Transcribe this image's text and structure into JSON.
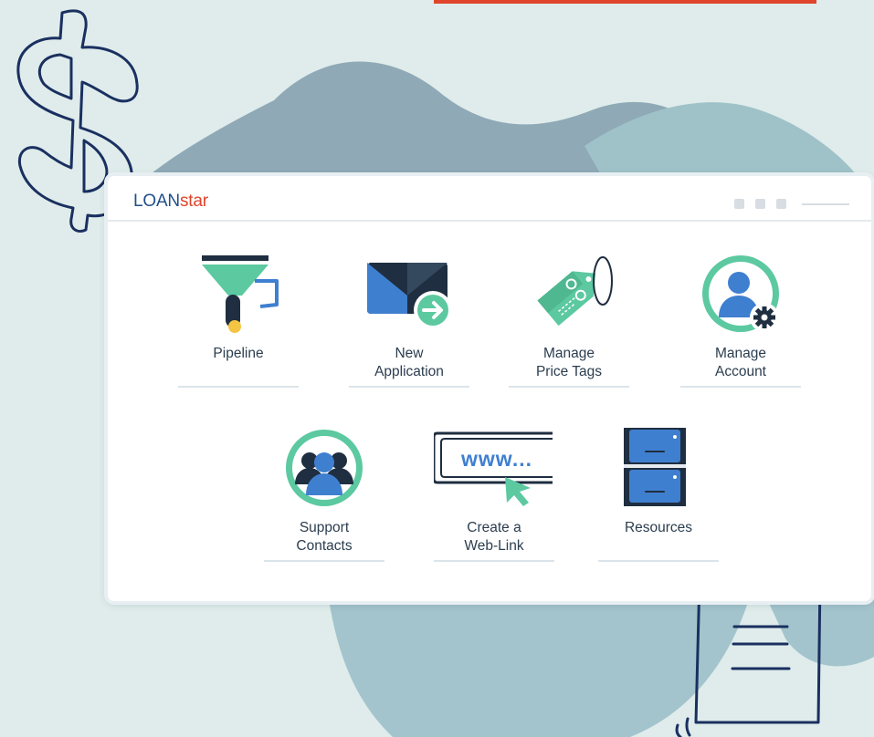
{
  "app": {
    "logo_part1": "LOAN",
    "logo_part2": "star"
  },
  "tiles": [
    {
      "label_line1": "Pipeline",
      "label_line2": "",
      "icon": "funnel-icon"
    },
    {
      "label_line1": "New",
      "label_line2": "Application",
      "icon": "envelope-arrow-icon"
    },
    {
      "label_line1": "Manage",
      "label_line2": "Price Tags",
      "icon": "price-tag-icon"
    },
    {
      "label_line1": "Manage",
      "label_line2": "Account",
      "icon": "user-gear-icon"
    },
    {
      "label_line1": "Support",
      "label_line2": "Contacts",
      "icon": "group-icon"
    },
    {
      "label_line1": "Create a",
      "label_line2": "Web-Link",
      "icon": "web-link-icon"
    },
    {
      "label_line1": "Resources",
      "label_line2": "",
      "icon": "file-cabinet-icon"
    }
  ],
  "weblink_icon_text": "www...",
  "colors": {
    "accent_green": "#5cc9a1",
    "accent_blue": "#3f7fd0",
    "dark_navy": "#1f2e40",
    "logo_blue": "#1f4f8a",
    "logo_red": "#e0442b",
    "background": "#dfeceb"
  }
}
